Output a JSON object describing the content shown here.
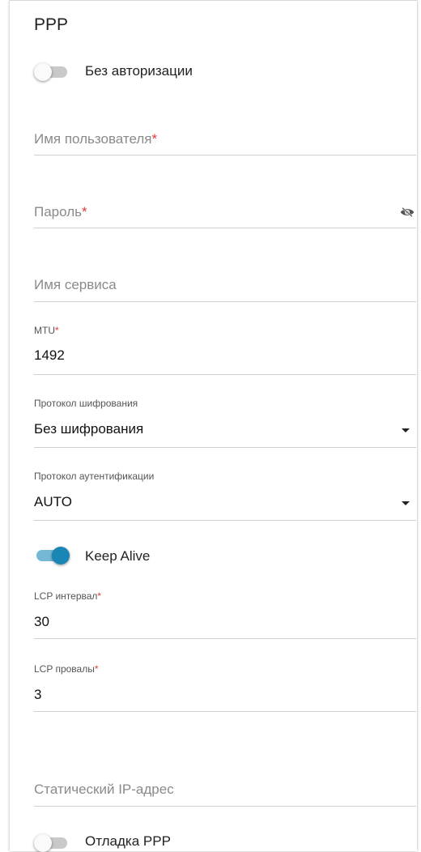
{
  "section": {
    "title": "PPP"
  },
  "no_auth": {
    "label": "Без авторизации",
    "enabled": false
  },
  "username": {
    "placeholder": "Имя пользователя",
    "required_mark": "*"
  },
  "password": {
    "placeholder": "Пароль",
    "required_mark": "*",
    "icon": "eye-off-icon"
  },
  "service_name": {
    "placeholder": "Имя сервиса"
  },
  "mtu": {
    "label": "MTU",
    "required_mark": "*",
    "value": "1492"
  },
  "encryption": {
    "label": "Протокол шифрования",
    "value": "Без шифрования"
  },
  "auth_protocol": {
    "label": "Протокол аутентификации",
    "value": "AUTO"
  },
  "keep_alive": {
    "label": "Keep Alive",
    "enabled": true
  },
  "lcp_interval": {
    "label": "LCP интервал",
    "required_mark": "*",
    "value": "30"
  },
  "lcp_failures": {
    "label": "LCP провалы",
    "required_mark": "*",
    "value": "3"
  },
  "static_ip": {
    "placeholder": "Статический IP-адрес"
  },
  "ppp_debug": {
    "label": "Отладка PPP",
    "enabled": false
  },
  "colors": {
    "accent": "#1a86b5",
    "required": "#e03a3a",
    "track_on": "#74b8d6",
    "track_off": "#c9c9c9"
  }
}
